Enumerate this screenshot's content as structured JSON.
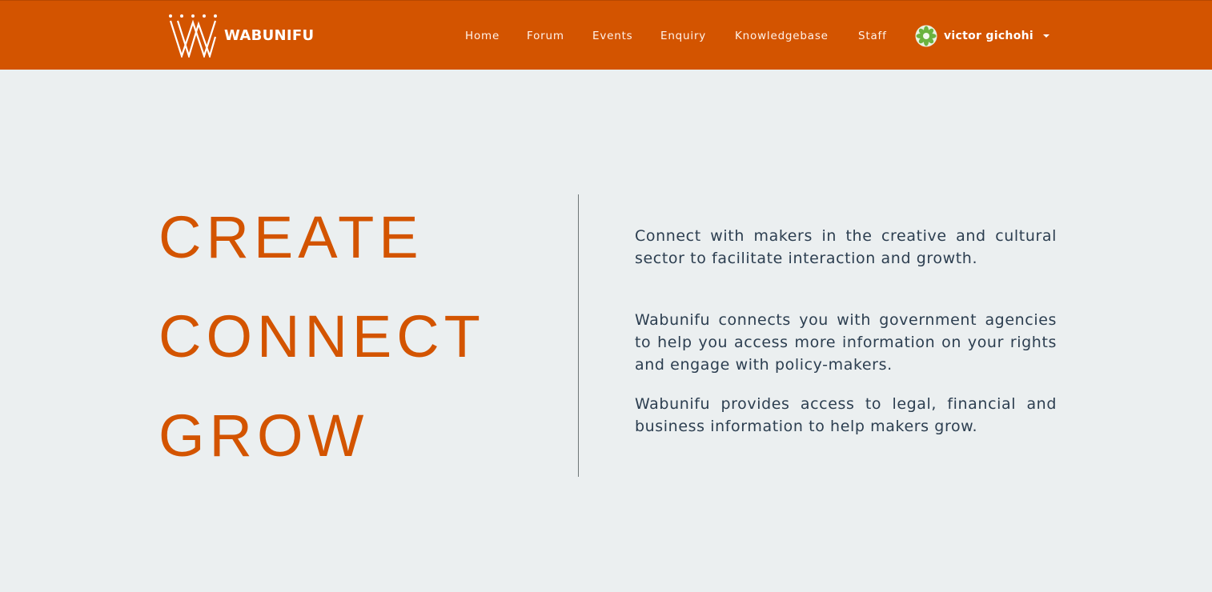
{
  "brand": {
    "name": "WABUNIFU"
  },
  "nav": {
    "items": [
      {
        "label": "Home"
      },
      {
        "label": "Forum"
      },
      {
        "label": "Events"
      },
      {
        "label": "Enquiry"
      },
      {
        "label": "Knowledgebase"
      },
      {
        "label": "Staff"
      }
    ],
    "user": {
      "name": "victor gichohi",
      "avatar_icon": "flower-avatar-icon"
    }
  },
  "hero": {
    "words": [
      "CREATE",
      "CONNECT",
      "GROW"
    ],
    "paragraphs": [
      "Connect with makers in the creative and cultural sector to facilitate interaction and growth.",
      "Wabunifu connects you with government agencies to help you access more information on your rights and engage with policy-makers.",
      "Wabunifu provides access to legal, financial and business information to help makers grow."
    ]
  },
  "colors": {
    "brand": "#d35400",
    "background": "#ebeff0",
    "body_text": "#2c3e50",
    "nav_text": "#ffffff"
  }
}
